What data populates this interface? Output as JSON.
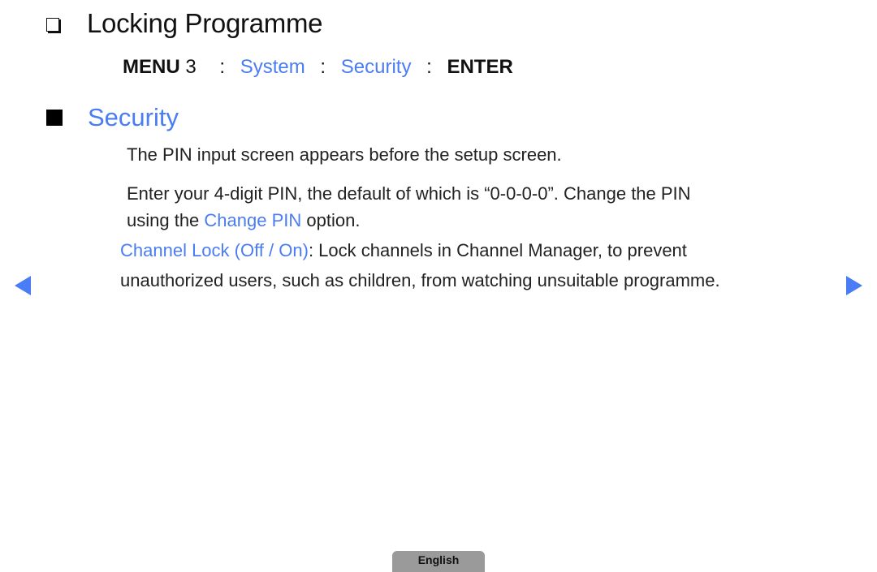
{
  "page": {
    "title": "Locking Programme",
    "menu_path": {
      "menu_label": "MENU",
      "menu_icon": "3",
      "separator": ":",
      "items": [
        "System",
        "Security"
      ],
      "enter_label": "ENTER"
    },
    "section": {
      "title": "Security",
      "paragraph_1": "The PIN input screen appears before the setup screen.",
      "paragraph_2_line_1": "Enter your 4-digit PIN, the default of which is “0-0-0-0”. Change the PIN",
      "paragraph_2_line_2_prefix": "using the ",
      "paragraph_2_link": "Change PIN",
      "paragraph_2_line_2_suffix": " option.",
      "item_label": "Channel Lock (Off / On)",
      "item_text_line_1": ": Lock channels in Channel Manager, to prevent",
      "item_text_line_2": "unauthorized users, such as children, from watching unsuitable programme."
    },
    "navigation": {
      "prev_icon": "triangle-left-icon",
      "next_icon": "triangle-right-icon"
    },
    "footer": {
      "language_tab": "English"
    },
    "colors": {
      "accent": "#4a7cf5",
      "text": "#222222",
      "tab_bg": "#9a9a9a"
    }
  }
}
